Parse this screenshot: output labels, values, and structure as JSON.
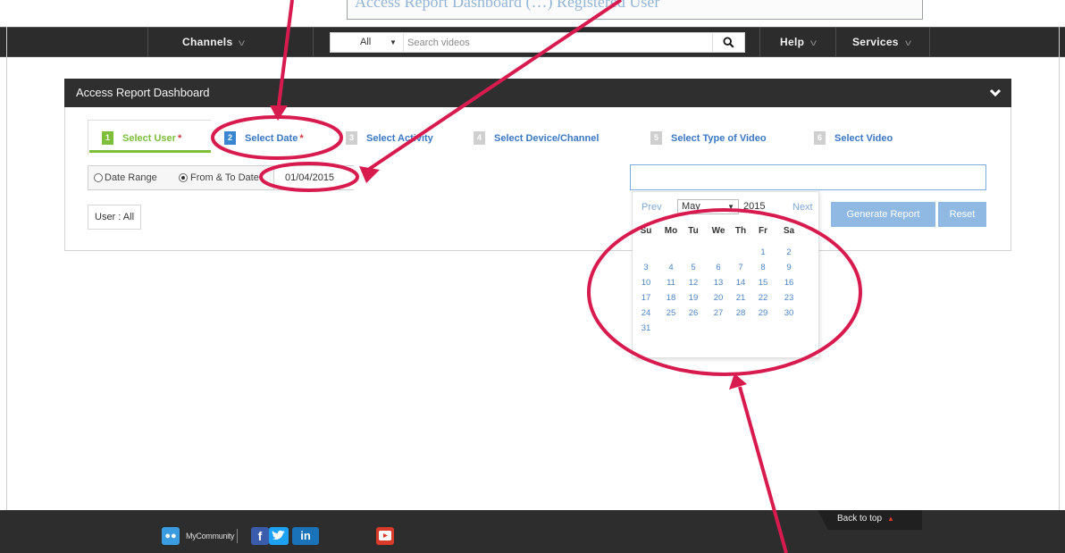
{
  "banner": {
    "text": "Access Report Dashboard (…) Registered User"
  },
  "nav": {
    "channels": "Channels",
    "search_scope": "All",
    "search_placeholder": "Search videos",
    "help": "Help",
    "services": "Services"
  },
  "dashboard": {
    "title": "Access Report Dashboard",
    "steps": [
      {
        "num": "1",
        "label": "Select User",
        "required": "*"
      },
      {
        "num": "2",
        "label": "Select Date",
        "required": "*"
      },
      {
        "num": "3",
        "label": "Select Activity"
      },
      {
        "num": "4",
        "label": "Select Device/Channel"
      },
      {
        "num": "5",
        "label": "Select Type of Video"
      },
      {
        "num": "6",
        "label": "Select Video"
      }
    ],
    "date_range_label": "Date Range",
    "from_to_label": "From & To Date",
    "from_date_value": "01/04/2015",
    "user_chip": "User : All",
    "generate_label": "Generate Report",
    "reset_label": "Reset"
  },
  "calendar": {
    "prev": "Prev",
    "next": "Next",
    "month": "May",
    "year": "2015",
    "weekdays": [
      "Su",
      "Mo",
      "Tu",
      "We",
      "Th",
      "Fr",
      "Sa"
    ],
    "days": [
      "1",
      "2",
      "3",
      "4",
      "5",
      "6",
      "7",
      "8",
      "9",
      "10",
      "11",
      "12",
      "13",
      "14",
      "15",
      "16",
      "17",
      "18",
      "19",
      "20",
      "21",
      "22",
      "23",
      "24",
      "25",
      "26",
      "27",
      "28",
      "29",
      "30",
      "31"
    ],
    "first_weekday_index": 5
  },
  "footer": {
    "community_label": "MyCommunity",
    "back_to_top": "Back to top",
    "social_icons": [
      "facebook-icon",
      "twitter-icon",
      "linkedin-icon",
      "youtube-icon"
    ]
  },
  "colors": {
    "nav_bg": "#2c2c2c",
    "step_green": "#7dbf3a",
    "step_blue": "#3a86d0",
    "button_blue": "#8fb9e3",
    "annotation_red": "#d81b4f"
  }
}
